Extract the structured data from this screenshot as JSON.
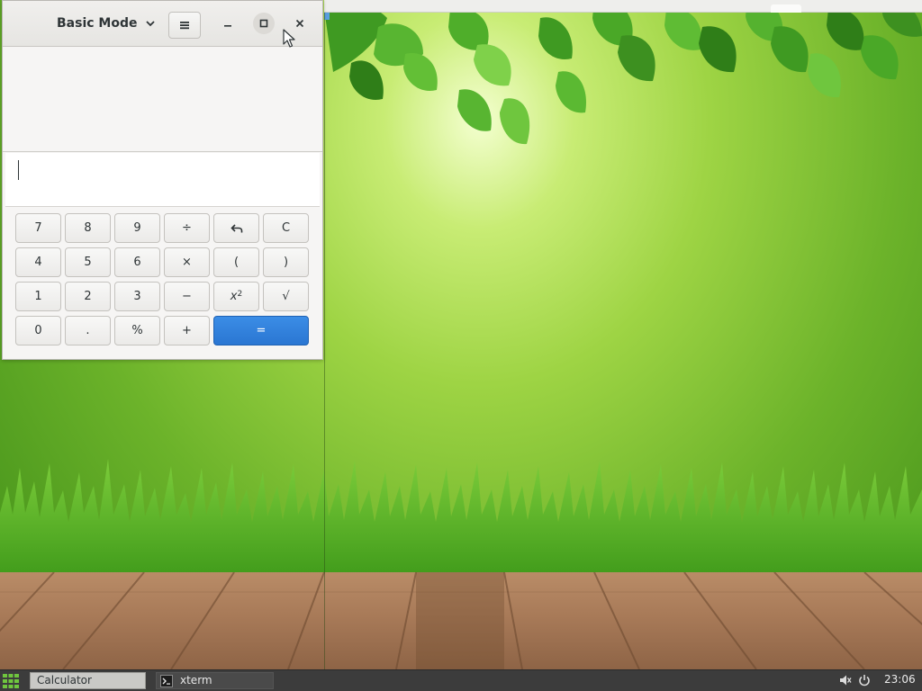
{
  "calculator": {
    "mode_label": "Basic Mode",
    "entry_value": "",
    "keys": {
      "seven": "7",
      "eight": "8",
      "nine": "9",
      "divide": "÷",
      "undo_icon": "undo-icon",
      "clear": "C",
      "four": "4",
      "five": "5",
      "six": "6",
      "multiply": "×",
      "open_paren": "(",
      "close_paren": ")",
      "one": "1",
      "two": "2",
      "three": "3",
      "subtract": "−",
      "square_base": "x",
      "square_exp": "2",
      "sqrt": "√",
      "zero": "0",
      "decimal": ".",
      "percent": "%",
      "add": "+",
      "equals": "="
    },
    "accent_color": "#2a76d2"
  },
  "taskbar": {
    "items": [
      {
        "label": "Calculator",
        "active": true
      },
      {
        "label": "xterm",
        "active": false
      }
    ],
    "clock": "23:06"
  }
}
